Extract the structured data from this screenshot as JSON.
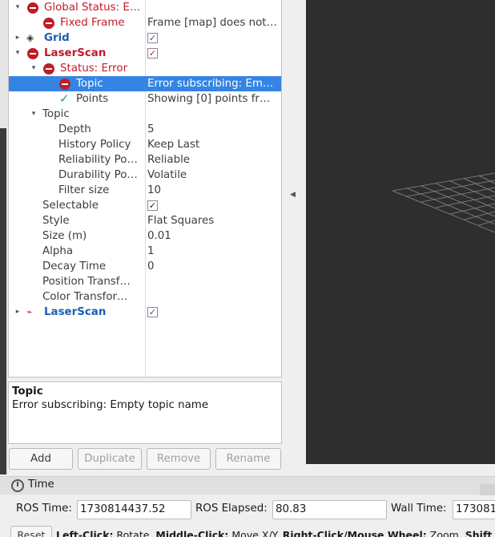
{
  "tree": [
    {
      "indent": 0,
      "arrow": "down",
      "icon": "error",
      "label": "Global Status: E…",
      "style": "red",
      "value": ""
    },
    {
      "indent": 1,
      "arrow": "",
      "icon": "error",
      "label": "Fixed Frame",
      "style": "red",
      "value": "Frame [map] does not…"
    },
    {
      "indent": 0,
      "arrow": "right",
      "icon": "grid",
      "label": "Grid",
      "style": "blue",
      "check": "blue"
    },
    {
      "indent": 0,
      "arrow": "down",
      "icon": "error",
      "label": "LaserScan",
      "style": "redbold",
      "check": "red"
    },
    {
      "indent": 1,
      "arrow": "down",
      "icon": "error",
      "label": "Status: Error",
      "style": "red",
      "value": ""
    },
    {
      "indent": 2,
      "arrow": "",
      "icon": "error",
      "label": "Topic",
      "style": "white",
      "value": "Error subscribing: Em…",
      "selected": true
    },
    {
      "indent": 2,
      "arrow": "",
      "icon": "check",
      "label": "Points",
      "style": "",
      "value": "Showing [0] points fr…"
    },
    {
      "indent": 1,
      "arrow": "down",
      "icon": "",
      "label": "Topic",
      "style": "",
      "value": ""
    },
    {
      "indent": 2,
      "arrow": "",
      "icon": "",
      "label": "Depth",
      "style": "",
      "value": "5"
    },
    {
      "indent": 2,
      "arrow": "",
      "icon": "",
      "label": "History Policy",
      "style": "",
      "value": "Keep Last"
    },
    {
      "indent": 2,
      "arrow": "",
      "icon": "",
      "label": "Reliability Po…",
      "style": "",
      "value": "Reliable"
    },
    {
      "indent": 2,
      "arrow": "",
      "icon": "",
      "label": "Durability Po…",
      "style": "",
      "value": "Volatile"
    },
    {
      "indent": 2,
      "arrow": "",
      "icon": "",
      "label": "Filter size",
      "style": "",
      "value": "10"
    },
    {
      "indent": 1,
      "arrow": "",
      "icon": "",
      "label": "Selectable",
      "style": "",
      "check": "plain"
    },
    {
      "indent": 1,
      "arrow": "",
      "icon": "",
      "label": "Style",
      "style": "",
      "value": "Flat Squares"
    },
    {
      "indent": 1,
      "arrow": "",
      "icon": "",
      "label": "Size (m)",
      "style": "",
      "value": "0.01"
    },
    {
      "indent": 1,
      "arrow": "",
      "icon": "",
      "label": "Alpha",
      "style": "",
      "value": "1"
    },
    {
      "indent": 1,
      "arrow": "",
      "icon": "",
      "label": "Decay Time",
      "style": "",
      "value": "0"
    },
    {
      "indent": 1,
      "arrow": "",
      "icon": "",
      "label": "Position Transf…",
      "style": "",
      "value": ""
    },
    {
      "indent": 1,
      "arrow": "",
      "icon": "",
      "label": "Color Transfor…",
      "style": "",
      "value": ""
    },
    {
      "indent": 0,
      "arrow": "right",
      "icon": "laser",
      "label": "LaserScan",
      "style": "blue",
      "check": "blue"
    }
  ],
  "description": {
    "title": "Topic",
    "body": "Error subscribing: Empty topic name"
  },
  "buttons": {
    "add": "Add",
    "duplicate": "Duplicate",
    "remove": "Remove",
    "rename": "Rename"
  },
  "time": {
    "title": "Time",
    "ros_time_label": "ROS Time:",
    "ros_time": "1730814437.52",
    "ros_elapsed_label": "ROS Elapsed:",
    "ros_elapsed": "80.83",
    "wall_time_label": "Wall Time:",
    "wall_time": "173081"
  },
  "status": {
    "reset": "Reset",
    "hint_html": "Left-Click: Rotate. Middle-Click: Move X/Y. Right-Click/Mouse Wheel: Zoom. Shift"
  },
  "colors": {
    "error": "#c01c28",
    "link": "#1a5fb4",
    "selection": "#3584e4",
    "viewport": "#2e2e2e"
  }
}
